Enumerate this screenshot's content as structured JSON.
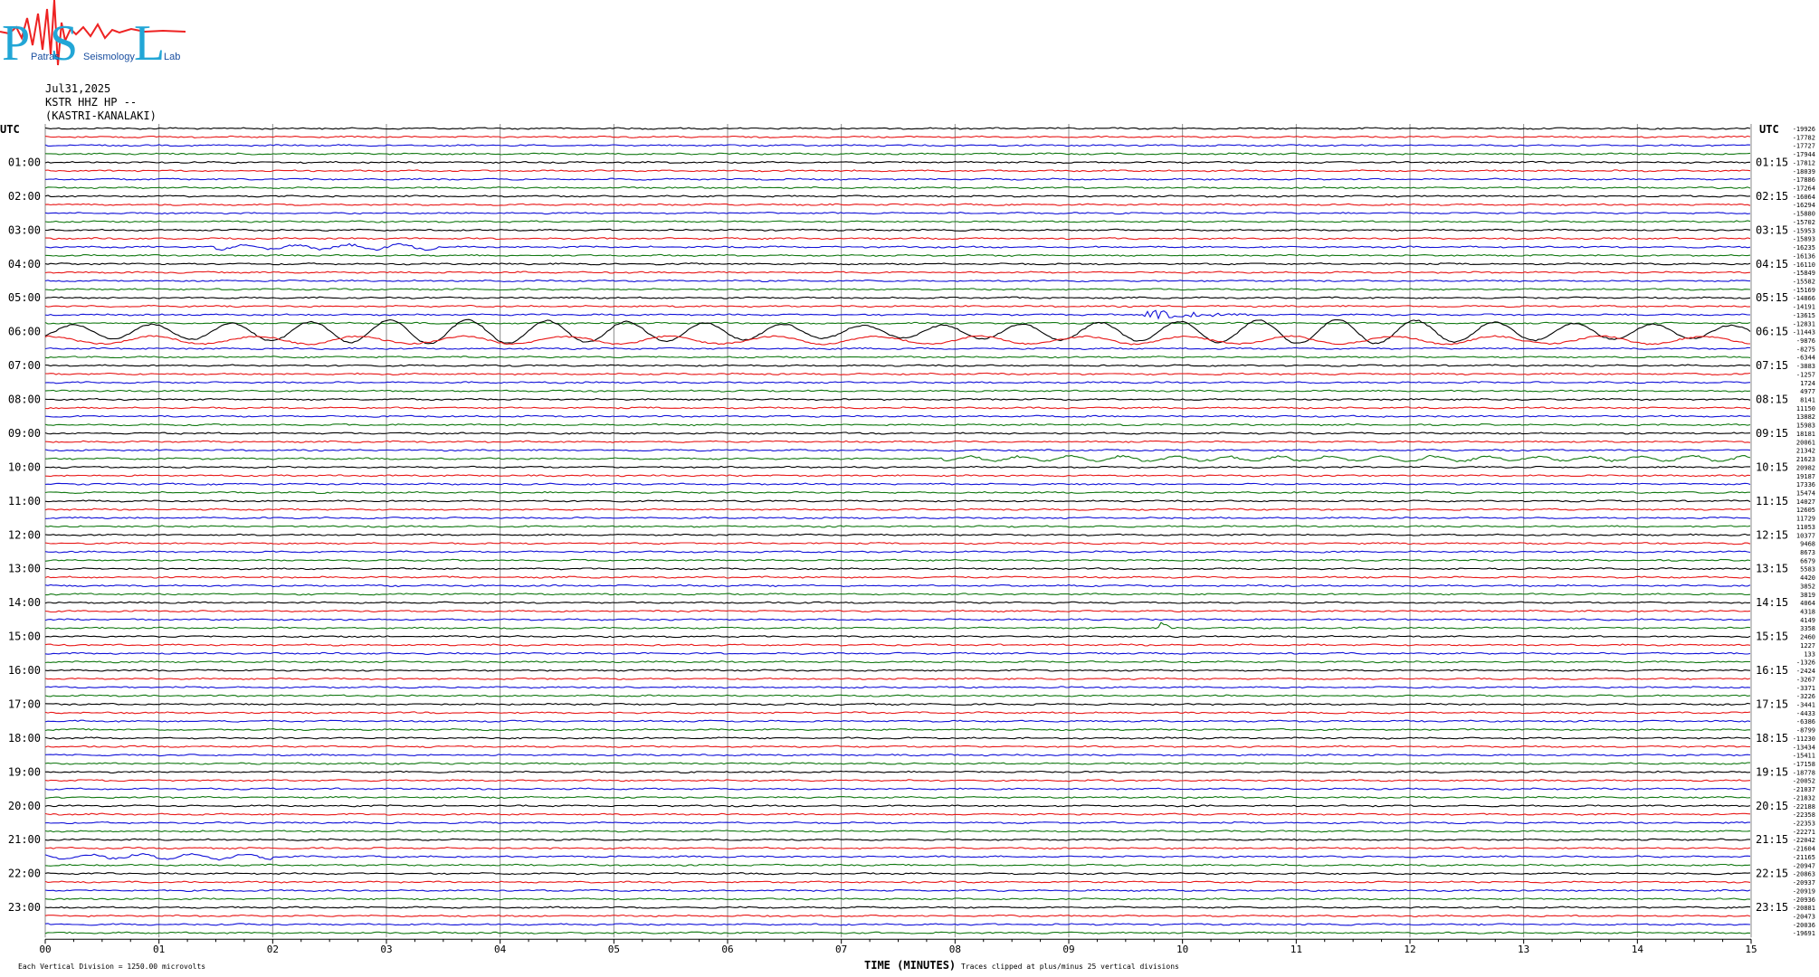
{
  "logo": {
    "letters": [
      "P",
      "S",
      "L"
    ],
    "words": [
      "Patras",
      "Seismology",
      "Lab"
    ],
    "colors": {
      "letters": "#22a6d6",
      "trace": "#ee2222",
      "words": "#1a4fa0"
    }
  },
  "header": {
    "date": "Jul31,2025",
    "channel": "KSTR HHZ HP --",
    "station": "(KASTRI-KANALAKI)"
  },
  "chart_data": {
    "type": "line",
    "subtype": "helicorder",
    "left_axis_label": "UTC",
    "right_axis_label": "UTC",
    "left_hours": [
      "01:00",
      "02:00",
      "03:00",
      "04:00",
      "05:00",
      "06:00",
      "07:00",
      "08:00",
      "09:00",
      "10:00",
      "11:00",
      "12:00",
      "13:00",
      "14:00",
      "15:00",
      "16:00",
      "17:00",
      "18:00",
      "19:00",
      "20:00",
      "21:00",
      "22:00",
      "23:00"
    ],
    "right_hours": [
      "01:15",
      "02:15",
      "03:15",
      "04:15",
      "05:15",
      "06:15",
      "07:15",
      "08:15",
      "09:15",
      "10:15",
      "11:15",
      "12:15",
      "13:15",
      "14:15",
      "15:15",
      "16:15",
      "17:15",
      "18:15",
      "19:15",
      "20:15",
      "21:15",
      "22:15",
      "23:15"
    ],
    "x_ticks": [
      "00",
      "01",
      "02",
      "03",
      "04",
      "05",
      "06",
      "07",
      "08",
      "09",
      "10",
      "11",
      "12",
      "13",
      "14",
      "15"
    ],
    "xlim": [
      0,
      15
    ],
    "xlabel": "TIME (MINUTES)",
    "lines_per_hour": 4,
    "trace_colors": [
      "#000000",
      "#e81818",
      "#1212d8",
      "#127812"
    ],
    "grid": true,
    "offsets": [
      -19926,
      -17782,
      -17727,
      -17944,
      -17812,
      -18039,
      -17886,
      -17264,
      -16064,
      -16294,
      -15880,
      -15702,
      -15953,
      -15893,
      -16235,
      -16136,
      -16110,
      -15849,
      -15582,
      -15169,
      -14866,
      -14191,
      -13615,
      -12831,
      -11443,
      -9876,
      -8275,
      -6344,
      -3883,
      -1257,
      1724,
      4977,
      8141,
      11150,
      13882,
      15983,
      18181,
      20061,
      21342,
      21623,
      20982,
      19187,
      17336,
      15474,
      14027,
      12605,
      11729,
      11053,
      10377,
      9468,
      8673,
      6679,
      5583,
      4420,
      3852,
      3819,
      4064,
      4318,
      4149,
      3358,
      2460,
      1227,
      133,
      -1326,
      -2424,
      -3267,
      -3371,
      -3226,
      -3441,
      -4433,
      -6386,
      -8799,
      -11230,
      -13434,
      -15411,
      -17158,
      -18778,
      -20052,
      -21037,
      -21832,
      -22188,
      -22358,
      -22353,
      -22271,
      -22042,
      -21604,
      -21165,
      -20947,
      -20863,
      -20937,
      -20919,
      -20936,
      -20881,
      -20473,
      -20036,
      -19691
    ],
    "events": [
      {
        "line": 22,
        "start_min": 9.6,
        "end_min": 10.9,
        "amplitude": "large",
        "note": "early coda on blue trace"
      },
      {
        "line": 24,
        "start_min": 0.0,
        "end_min": 15.0,
        "amplitude": "very large",
        "note": "long-period surface waves"
      },
      {
        "line": 25,
        "start_min": 0.0,
        "end_min": 15.0,
        "amplitude": "large",
        "note": "long-period surface waves"
      },
      {
        "line": 14,
        "start_min": 1.5,
        "end_min": 3.5,
        "amplitude": "medium",
        "note": "long-period ripple"
      },
      {
        "line": 39,
        "start_min": 7.9,
        "end_min": 15.0,
        "amplitude": "medium",
        "note": "high-frequency burst"
      },
      {
        "line": 59,
        "start_min": 9.75,
        "end_min": 9.95,
        "amplitude": "spike",
        "note": "local event"
      },
      {
        "line": 86,
        "start_min": 0.0,
        "end_min": 2.0,
        "amplitude": "medium",
        "note": "long-period ripple"
      }
    ]
  },
  "footer": {
    "left_note": "Each Vertical Division = 1250.00 microvolts",
    "right_note": "Traces clipped at plus/minus 25 vertical divisions"
  }
}
